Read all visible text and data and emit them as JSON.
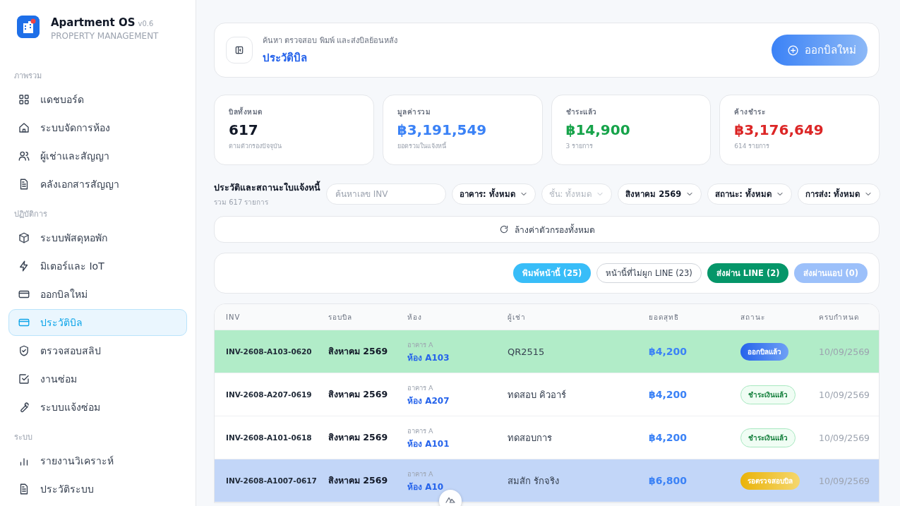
{
  "app": {
    "name": "Apartment OS",
    "version": "v0.6",
    "subtitle": "PROPERTY MANAGEMENT"
  },
  "sidebar": {
    "sections": [
      {
        "title": "ภาพรวม",
        "items": [
          {
            "label": "แดชบอร์ด",
            "selected": false
          },
          {
            "label": "ระบบจัดการห้อง",
            "selected": false
          },
          {
            "label": "ผู้เช่าและสัญญา",
            "selected": false
          },
          {
            "label": "คลังเอกสารสัญญา",
            "selected": false
          }
        ]
      },
      {
        "title": "ปฏิบัติการ",
        "items": [
          {
            "label": "ระบบพัสดุหอพัก",
            "selected": false
          },
          {
            "label": "มิเตอร์และ IoT",
            "selected": false
          },
          {
            "label": "ออกบิลใหม่",
            "selected": false
          },
          {
            "label": "ประวัติบิล",
            "selected": true
          },
          {
            "label": "ตรวจสอบสลิป",
            "selected": false
          },
          {
            "label": "งานซ่อม",
            "selected": false
          },
          {
            "label": "ระบบแจ้งซ่อม",
            "selected": false
          }
        ]
      },
      {
        "title": "ระบบ",
        "items": [
          {
            "label": "รายงานวิเคราะห์",
            "selected": false
          },
          {
            "label": "ประวัติระบบ",
            "selected": false
          }
        ]
      }
    ]
  },
  "header": {
    "subtitle": "ค้นหา ตรวจสอบ พิมพ์ และส่งบิลย้อนหลัง",
    "title": "ประวัติบิล",
    "action": "ออกบิลใหม่"
  },
  "stats": [
    {
      "label": "บิลทั้งหมด",
      "value": "617",
      "note": "ตามตัวกรองปัจจุบัน",
      "color": "#111827"
    },
    {
      "label": "มูลค่ารวม",
      "value": "฿3,191,549",
      "note": "ยอดรวมในแจ้งหนี้",
      "color": "#3b82f6"
    },
    {
      "label": "ชำระแล้ว",
      "value": "฿14,900",
      "note": "3 รายการ",
      "color": "#16a34a"
    },
    {
      "label": "ค้างชำระ",
      "value": "฿3,176,649",
      "note": "614 รายการ",
      "color": "#dc2626"
    }
  ],
  "filters": {
    "title": "ประวัติและสถานะใบแจ้งหนี้",
    "count": "รวม 617 รายการ",
    "search": {
      "placeholder": "ค้นหาเลข INV"
    },
    "dropdowns": [
      {
        "label": "อาคาร: ทั้งหมด",
        "disabled": false
      },
      {
        "label": "ชั้น: ทั้งหมด",
        "disabled": true
      },
      {
        "label": "สิงหาคม 2569",
        "disabled": false
      },
      {
        "label": "สถานะ: ทั้งหมด",
        "disabled": false
      },
      {
        "label": "การส่ง: ทั้งหมด",
        "disabled": false
      }
    ],
    "reset": "ล้างค่าตัวกรองทั้งหมด"
  },
  "actions": [
    {
      "label": "พิมพ์หน้านี้ (25)",
      "kind": "print",
      "disabled": false
    },
    {
      "label": "หน้านี้ที่ไม่ผูก LINE (23)",
      "kind": "outline",
      "disabled": false
    },
    {
      "label": "ส่งผ่าน LINE (2)",
      "kind": "line",
      "disabled": false
    },
    {
      "label": "ส่งผ่านแอป (0)",
      "kind": "app",
      "disabled": true
    }
  ],
  "table": {
    "columns": [
      "INV",
      "รอบบิล",
      "ห้อง",
      "ผู้เช่า",
      "ยอดสุทธิ",
      "สถานะ",
      "ครบกำหนด"
    ],
    "rows": [
      {
        "inv": "INV-2608-A103-0620",
        "period": "สิงหาคม 2569",
        "building": "อาคาร A",
        "room": "ห้อง A103",
        "tenant": "QR2515",
        "amount": "฿4,200",
        "status": {
          "label": "ออกบิลแล้ว",
          "kind": "issued"
        },
        "due": "10/09/2569",
        "color": "#b1ecc8"
      },
      {
        "inv": "INV-2608-A207-0619",
        "period": "สิงหาคม 2569",
        "building": "อาคาร A",
        "room": "ห้อง A207",
        "tenant": "ทดสอบ คิวอาร์",
        "amount": "฿4,200",
        "status": {
          "label": "ชำระเงินแล้ว",
          "kind": "paid"
        },
        "due": "10/09/2569",
        "color": "#ffffff"
      },
      {
        "inv": "INV-2608-A101-0618",
        "period": "สิงหาคม 2569",
        "building": "อาคาร A",
        "room": "ห้อง A101",
        "tenant": "ทดสอบการ",
        "amount": "฿4,200",
        "status": {
          "label": "ชำระเงินแล้ว",
          "kind": "paid"
        },
        "due": "10/09/2569",
        "color": "#ffffff"
      },
      {
        "inv": "INV-2608-A1007-0617",
        "period": "สิงหาคม 2569",
        "building": "อาคาร A",
        "room": "ห้อง A10",
        "tenant": "สมสัก รักจริง",
        "amount": "฿6,800",
        "status": {
          "label": "รอตรวจสอบบิล",
          "kind": "pending"
        },
        "due": "10/09/2569",
        "color": "#c2d6f8"
      }
    ]
  }
}
